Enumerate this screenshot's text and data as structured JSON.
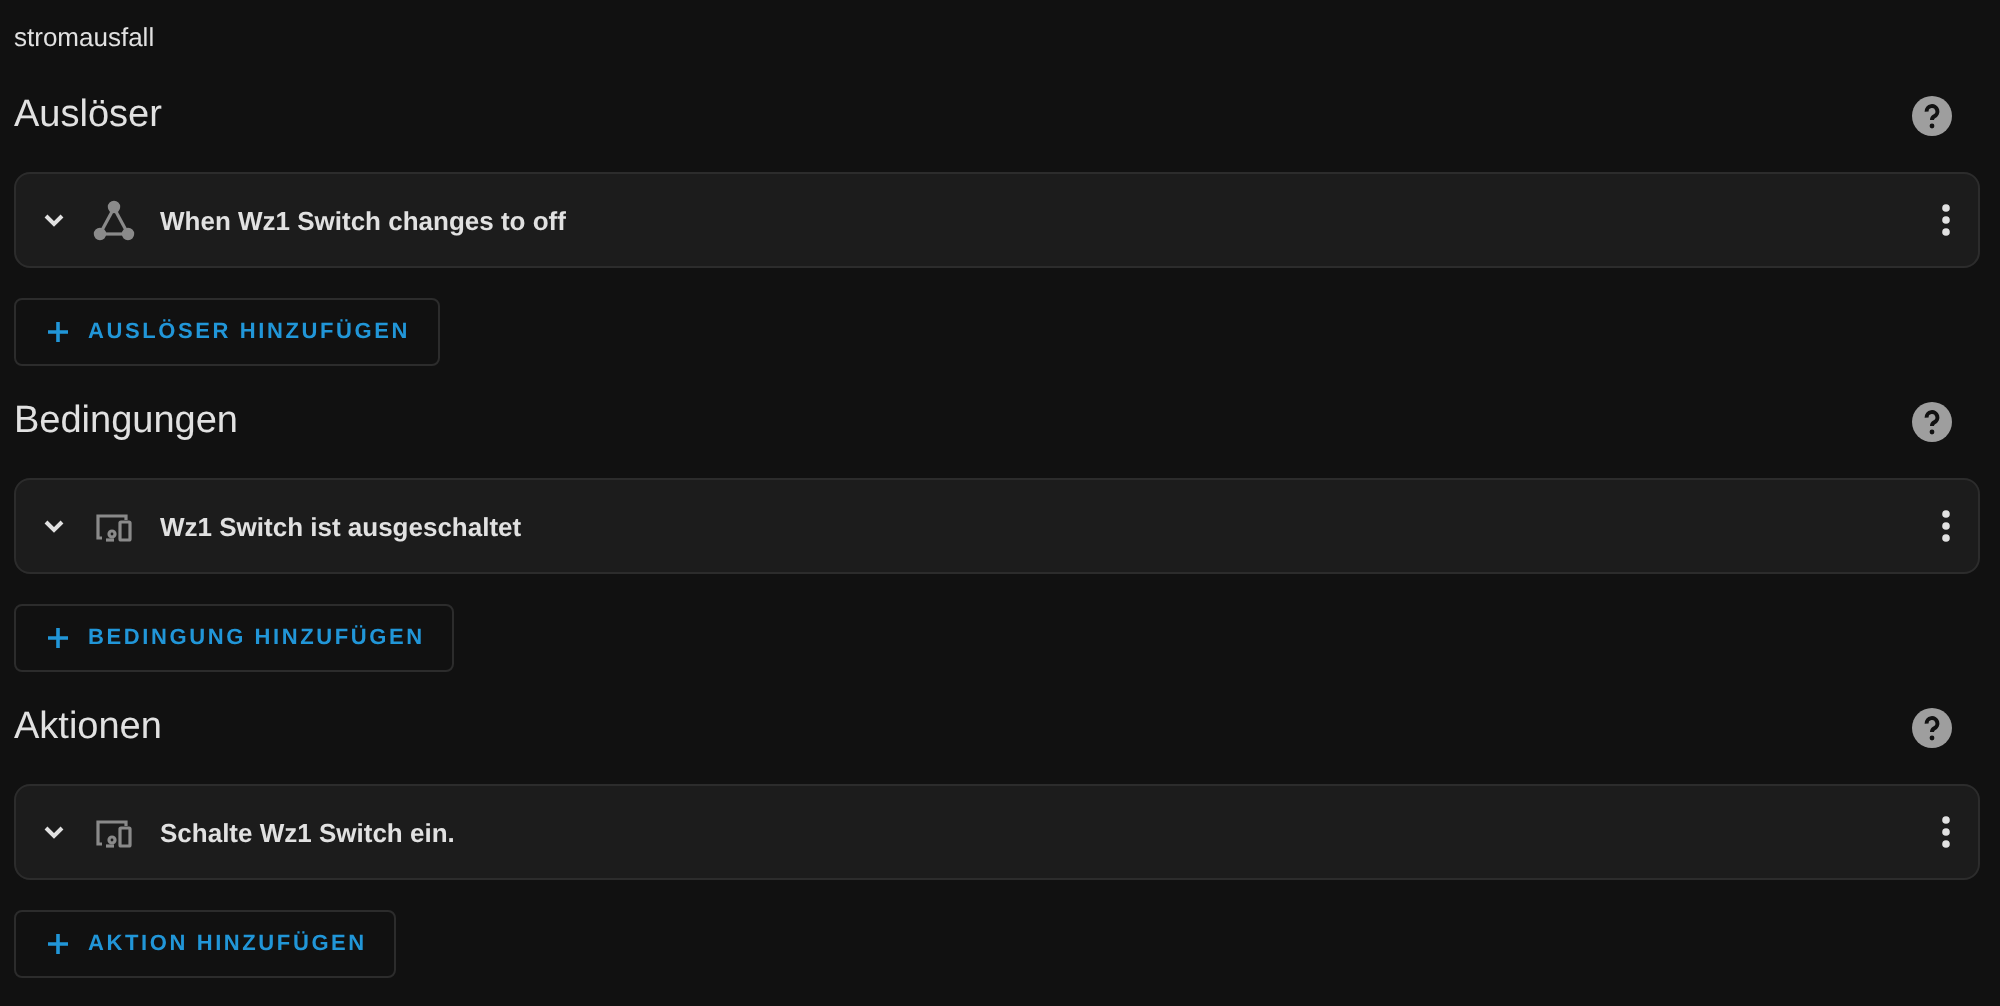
{
  "title": "stromausfall",
  "sections": [
    {
      "heading": "Auslöser",
      "items": [
        {
          "kind": "trigger",
          "label": "When Wz1 Switch changes to off"
        }
      ],
      "add_button": "AUSLÖSER HINZUFÜGEN"
    },
    {
      "heading": "Bedingungen",
      "items": [
        {
          "kind": "device",
          "label": "Wz1 Switch ist ausgeschaltet"
        }
      ],
      "add_button": "BEDINGUNG HINZUFÜGEN"
    },
    {
      "heading": "Aktionen",
      "items": [
        {
          "kind": "device",
          "label": "Schalte Wz1 Switch ein."
        }
      ],
      "add_button": "AKTION HINZUFÜGEN"
    }
  ]
}
